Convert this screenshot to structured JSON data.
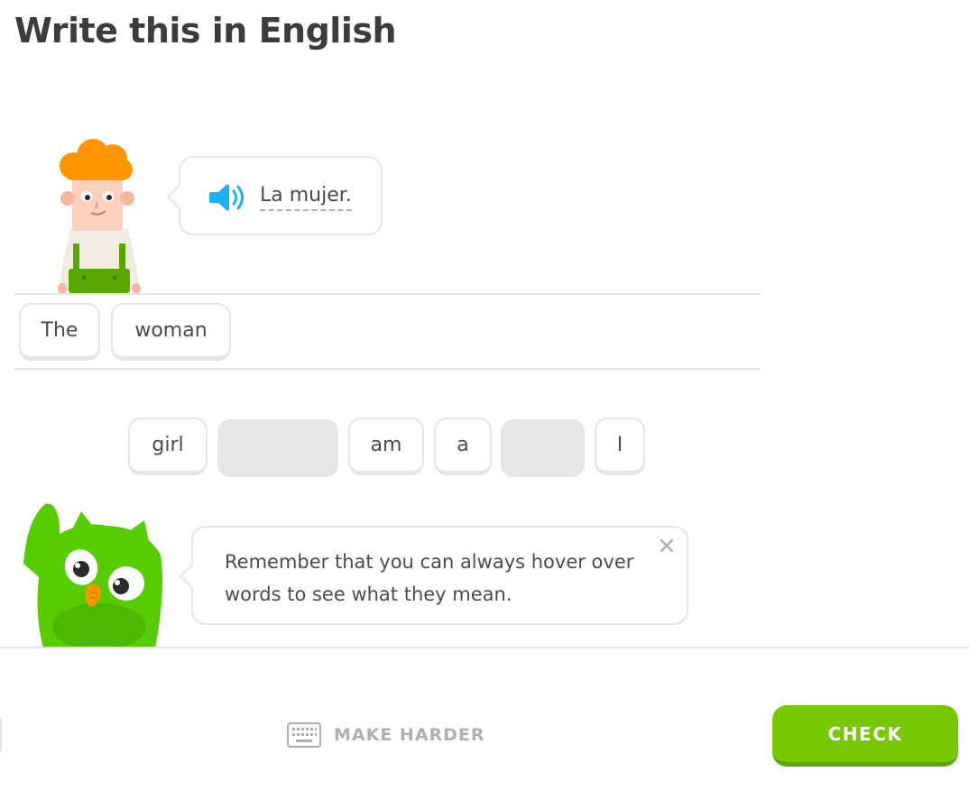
{
  "header": {
    "title": "Write this in English"
  },
  "prompt": {
    "text": "La mujer."
  },
  "answer": {
    "words": [
      "The",
      "woman"
    ]
  },
  "word_bank": {
    "words": [
      "girl",
      "am",
      "a",
      "I"
    ]
  },
  "tip": {
    "text": "Remember that you can always hover over words to see what they mean."
  },
  "footer": {
    "make_harder_label": "MAKE HARDER",
    "check_label": "CHECK"
  },
  "colors": {
    "accent_green": "#78c800",
    "accent_green_dark": "#58a700",
    "speaker_blue": "#1cb0f6",
    "border_gray": "#e5e5e5",
    "text_gray": "#4b4b4b",
    "muted_gray": "#afafaf"
  }
}
